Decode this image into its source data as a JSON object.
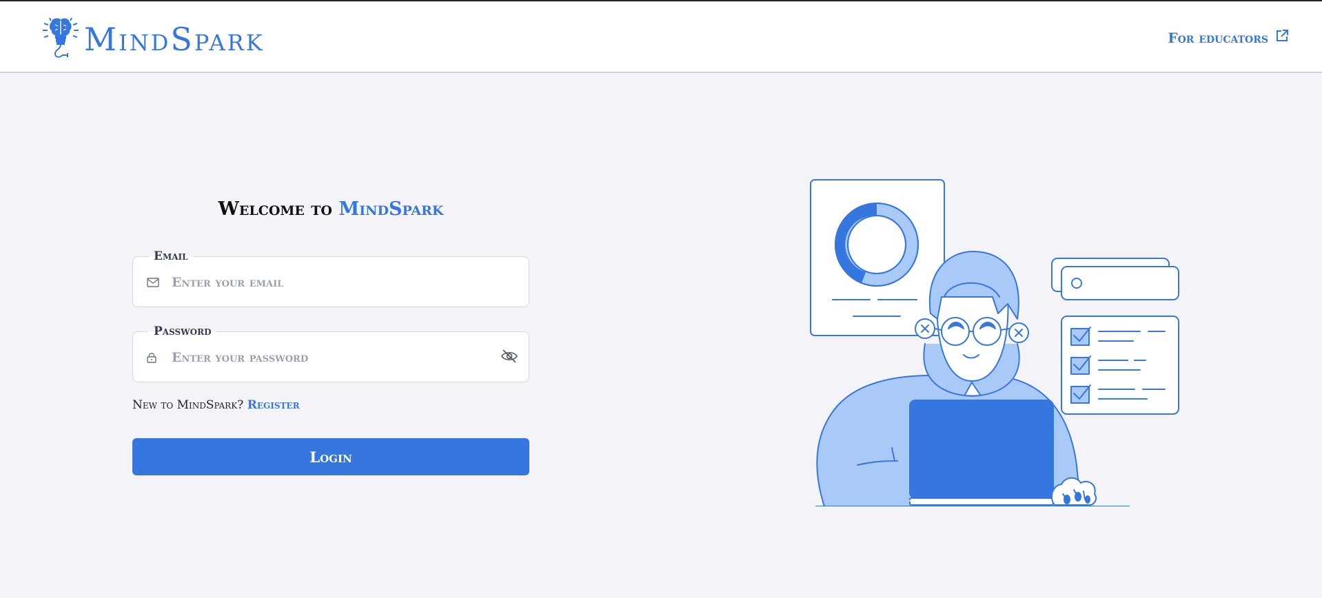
{
  "header": {
    "brand": "MindSpark",
    "educators_link": "For educators"
  },
  "login": {
    "welcome_prefix": "Welcome to ",
    "welcome_brand": "MindSpark",
    "email_label": "Email",
    "email_placeholder": "Enter your email",
    "password_label": "Password",
    "password_placeholder": "Enter your password",
    "register_prompt": "New to MindSpark?",
    "register_link": "Register",
    "login_button": "Login"
  },
  "icons": {
    "logo": "lightbulb-brain-icon",
    "external": "external-link-icon",
    "email": "mail-icon",
    "password": "lock-icon",
    "toggle": "eye-off-icon"
  },
  "colors": {
    "accent": "#3676df",
    "background": "#f4f4f8",
    "illustration_light": "#a9c9f7"
  }
}
